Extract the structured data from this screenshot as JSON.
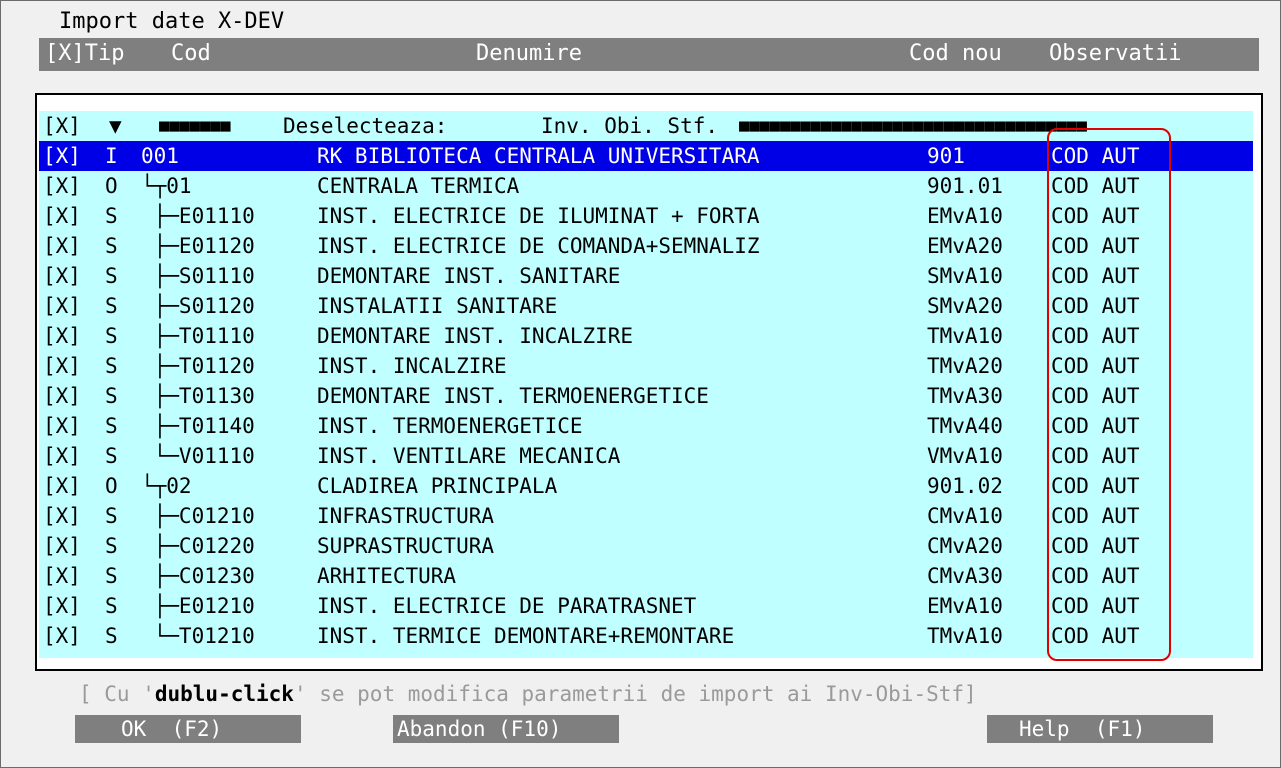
{
  "title": "Import date X-DEV",
  "columns": {
    "sel": "[X]Tip",
    "cod": "Cod",
    "denumire": "Denumire",
    "cod_nou": "Cod nou",
    "observatii": "Observatii"
  },
  "toolbar": {
    "check": "[X]",
    "arrow": "▼",
    "filler": "■■■■■■■",
    "label": "Deselecteaza:",
    "filter": "Inv. Obi. Stf.",
    "bar": "■■■■■■■■■■■■■■■■■■■■■■■■■■■■■■■■■■"
  },
  "rows": [
    {
      "sel": "[X]",
      "tip": "I",
      "cod": "001",
      "den": "RK BIBLIOTECA CENTRALA UNIVERSITARA",
      "nou": "901",
      "obs": "COD AUT"
    },
    {
      "sel": "[X]",
      "tip": "O",
      "cod": "└┬01",
      "den": "CENTRALA TERMICA",
      "nou": "901.01",
      "obs": "COD AUT"
    },
    {
      "sel": "[X]",
      "tip": "S",
      "cod": " ├─E01110",
      "den": "INST. ELECTRICE DE ILUMINAT + FORTA",
      "nou": "EMvA10",
      "obs": "COD AUT"
    },
    {
      "sel": "[X]",
      "tip": "S",
      "cod": " ├─E01120",
      "den": "INST. ELECTRICE DE COMANDA+SEMNALIZ",
      "nou": "EMvA20",
      "obs": "COD AUT"
    },
    {
      "sel": "[X]",
      "tip": "S",
      "cod": " ├─S01110",
      "den": "DEMONTARE INST. SANITARE",
      "nou": "SMvA10",
      "obs": "COD AUT"
    },
    {
      "sel": "[X]",
      "tip": "S",
      "cod": " ├─S01120",
      "den": "INSTALATII SANITARE",
      "nou": "SMvA20",
      "obs": "COD AUT"
    },
    {
      "sel": "[X]",
      "tip": "S",
      "cod": " ├─T01110",
      "den": "DEMONTARE INST. INCALZIRE",
      "nou": "TMvA10",
      "obs": "COD AUT"
    },
    {
      "sel": "[X]",
      "tip": "S",
      "cod": " ├─T01120",
      "den": "INST. INCALZIRE",
      "nou": "TMvA20",
      "obs": "COD AUT"
    },
    {
      "sel": "[X]",
      "tip": "S",
      "cod": " ├─T01130",
      "den": "DEMONTARE INST. TERMOENERGETICE",
      "nou": "TMvA30",
      "obs": "COD AUT"
    },
    {
      "sel": "[X]",
      "tip": "S",
      "cod": " ├─T01140",
      "den": "INST. TERMOENERGETICE",
      "nou": "TMvA40",
      "obs": "COD AUT"
    },
    {
      "sel": "[X]",
      "tip": "S",
      "cod": " └─V01110",
      "den": "INST. VENTILARE MECANICA",
      "nou": "VMvA10",
      "obs": "COD AUT"
    },
    {
      "sel": "[X]",
      "tip": "O",
      "cod": "└┬02",
      "den": "CLADIREA PRINCIPALA",
      "nou": "901.02",
      "obs": "COD AUT"
    },
    {
      "sel": "[X]",
      "tip": "S",
      "cod": " ├─C01210",
      "den": "INFRASTRUCTURA",
      "nou": "CMvA10",
      "obs": "COD AUT"
    },
    {
      "sel": "[X]",
      "tip": "S",
      "cod": " ├─C01220",
      "den": "SUPRASTRUCTURA",
      "nou": "CMvA20",
      "obs": "COD AUT"
    },
    {
      "sel": "[X]",
      "tip": "S",
      "cod": " ├─C01230",
      "den": "ARHITECTURA",
      "nou": "CMvA30",
      "obs": "COD AUT"
    },
    {
      "sel": "[X]",
      "tip": "S",
      "cod": " ├─E01210",
      "den": "INST. ELECTRICE DE PARATRASNET",
      "nou": "EMvA10",
      "obs": "COD AUT"
    },
    {
      "sel": "[X]",
      "tip": "S",
      "cod": " └─T01210",
      "den": "INST. TERMICE DEMONTARE+REMONTARE",
      "nou": "TMvA10",
      "obs": "COD AUT"
    }
  ],
  "hint": {
    "pre": "[ Cu '",
    "bold": "dublu-click",
    "post": "' se pot modifica parametrii de import ai Inv-Obi-Stf]"
  },
  "buttons": {
    "ok": "OK  (F2)",
    "abandon": "Abandon (F10)",
    "help": "Help  (F1)"
  },
  "colors": {
    "list_bg": "#c0ffff",
    "selection": "#0000e6",
    "header_bg": "#7f7f7f",
    "highlight_box": "#e00000"
  }
}
